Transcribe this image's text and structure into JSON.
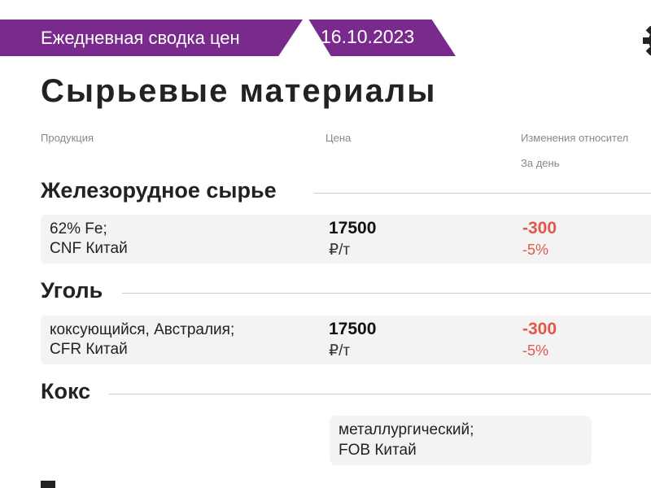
{
  "header": {
    "summary_label": "Ежедневная сводка цен",
    "date": "16.10.2023"
  },
  "page_title": "Сырьевые материалы",
  "columns": {
    "product": "Продукция",
    "price": "Цена",
    "change": "Изменения относител",
    "change_sub": "За день"
  },
  "sections": [
    {
      "title": "Железорудное сырье",
      "row": {
        "line1": "62% Fe;",
        "line2": "CNF Китай",
        "price": "17500",
        "unit": "₽/т",
        "change": "-300",
        "change_pct": "-5%"
      }
    },
    {
      "title": "Уголь",
      "row": {
        "line1": "коксующийся, Австралия;",
        "line2": "CFR Китай",
        "price": "17500",
        "unit": "₽/т",
        "change": "-300",
        "change_pct": "-5%"
      }
    },
    {
      "title": "Кокс",
      "row": {
        "line1": "металлургический;",
        "line2": "FOB Китай"
      }
    }
  ],
  "colors": {
    "ribbon": "#7a2a8c",
    "negative": "#e0584a"
  },
  "icons": {
    "settings": "gear-icon"
  }
}
